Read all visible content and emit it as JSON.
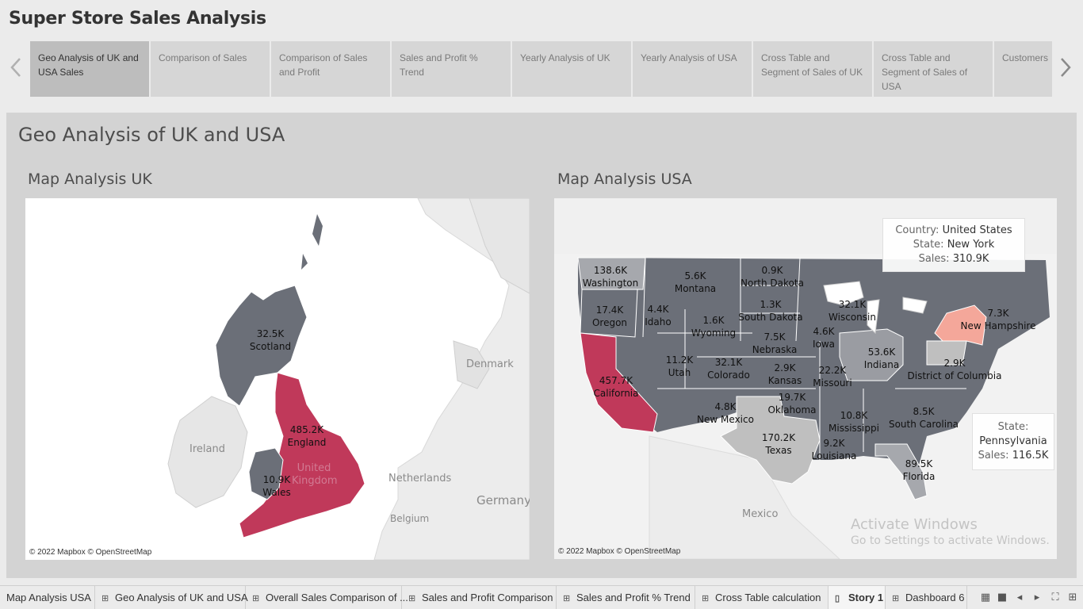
{
  "story": {
    "title": "Super Store Sales Analysis",
    "points": [
      {
        "label": "Geo Analysis of UK and USA Sales",
        "active": true
      },
      {
        "label": "Comparison of Sales",
        "active": false
      },
      {
        "label": "Comparison of Sales and Profit",
        "active": false
      },
      {
        "label": "Sales and Profit % Trend",
        "active": false
      },
      {
        "label": "Yearly Analysis of UK",
        "active": false
      },
      {
        "label": "Yearly Analysis of USA",
        "active": false
      },
      {
        "label": "Cross Table and Segment of Sales of UK",
        "active": false
      },
      {
        "label": "Cross Table and Segment of Sales of USA",
        "active": false
      },
      {
        "label": "Customers",
        "active": false
      }
    ]
  },
  "dashboard": {
    "title": "Geo Analysis of UK and USA",
    "uk_map": {
      "title": "Map Analysis UK",
      "attribution": "© 2022 Mapbox © OpenStreetMap",
      "regions": [
        {
          "name": "Scotland",
          "sales": "32.5K"
        },
        {
          "name": "England",
          "sales": "485.2K"
        },
        {
          "name": "Wales",
          "sales": "10.9K"
        }
      ],
      "geo_labels": [
        "Denmark",
        "Ireland",
        "United Kingdom",
        "Netherlands",
        "Germany",
        "Belgium"
      ]
    },
    "us_map": {
      "title": "Map Analysis USA",
      "attribution": "© 2022 Mapbox © OpenStreetMap",
      "states": [
        {
          "name": "Washington",
          "sales": "138.6K"
        },
        {
          "name": "Montana",
          "sales": "5.6K"
        },
        {
          "name": "North Dakota",
          "sales": "0.9K"
        },
        {
          "name": "Oregon",
          "sales": "17.4K"
        },
        {
          "name": "Idaho",
          "sales": "4.4K"
        },
        {
          "name": "Wyoming",
          "sales": "1.6K"
        },
        {
          "name": "South Dakota",
          "sales": "1.3K"
        },
        {
          "name": "Wisconsin",
          "sales": "32.1K"
        },
        {
          "name": "Iowa",
          "sales": "4.6K"
        },
        {
          "name": "Nebraska",
          "sales": "7.5K"
        },
        {
          "name": "California",
          "sales": "457.7K"
        },
        {
          "name": "Utah",
          "sales": "11.2K"
        },
        {
          "name": "Colorado",
          "sales": "32.1K"
        },
        {
          "name": "Kansas",
          "sales": "2.9K"
        },
        {
          "name": "Missouri",
          "sales": "22.2K"
        },
        {
          "name": "Indiana",
          "sales": "53.6K"
        },
        {
          "name": "District of Columbia",
          "sales": "2.9K"
        },
        {
          "name": "New Hampshire",
          "sales": "7.3K"
        },
        {
          "name": "Oklahoma",
          "sales": "19.7K"
        },
        {
          "name": "New Mexico",
          "sales": "4.8K"
        },
        {
          "name": "Texas",
          "sales": "170.2K"
        },
        {
          "name": "Mississippi",
          "sales": "10.8K"
        },
        {
          "name": "Louisiana",
          "sales": "9.2K"
        },
        {
          "name": "South Carolina",
          "sales": "8.5K"
        },
        {
          "name": "Florida",
          "sales": "89.5K"
        }
      ],
      "geo_labels": [
        "Mexico"
      ],
      "tooltip_ny": {
        "country_label": "Country:",
        "country": "United States",
        "state_label": "State:",
        "state": "New York",
        "sales_label": "Sales:",
        "sales": "310.9K"
      },
      "tooltip_pa": {
        "state_label": "State:",
        "state": "Pennsylvania",
        "sales_label": "Sales:",
        "sales": "116.5K"
      }
    }
  },
  "watermark": {
    "line1": "Activate Windows",
    "line2": "Go to Settings to activate Windows."
  },
  "tabs": [
    {
      "label": "Map Analysis USA",
      "icon": "none"
    },
    {
      "label": "Geo Analysis of UK and USA",
      "icon": "dashboard-icon"
    },
    {
      "label": "Overall Sales Comparison of ...",
      "icon": "dashboard-icon"
    },
    {
      "label": "Sales and Profit Comparison",
      "icon": "dashboard-icon"
    },
    {
      "label": "Sales and Profit % Trend",
      "icon": "dashboard-icon"
    },
    {
      "label": "Cross Table calculation",
      "icon": "dashboard-icon"
    },
    {
      "label": "Story 1",
      "icon": "story-icon",
      "active": true
    },
    {
      "label": "Dashboard 6",
      "icon": "dashboard-icon"
    }
  ],
  "colors": {
    "highlight_red": "#c0395a",
    "ny_salmon": "#f4a79a",
    "region_gray": "#6b6f78",
    "light_gray": "#bfbfbf",
    "panel_bg": "#d3d3d3"
  }
}
